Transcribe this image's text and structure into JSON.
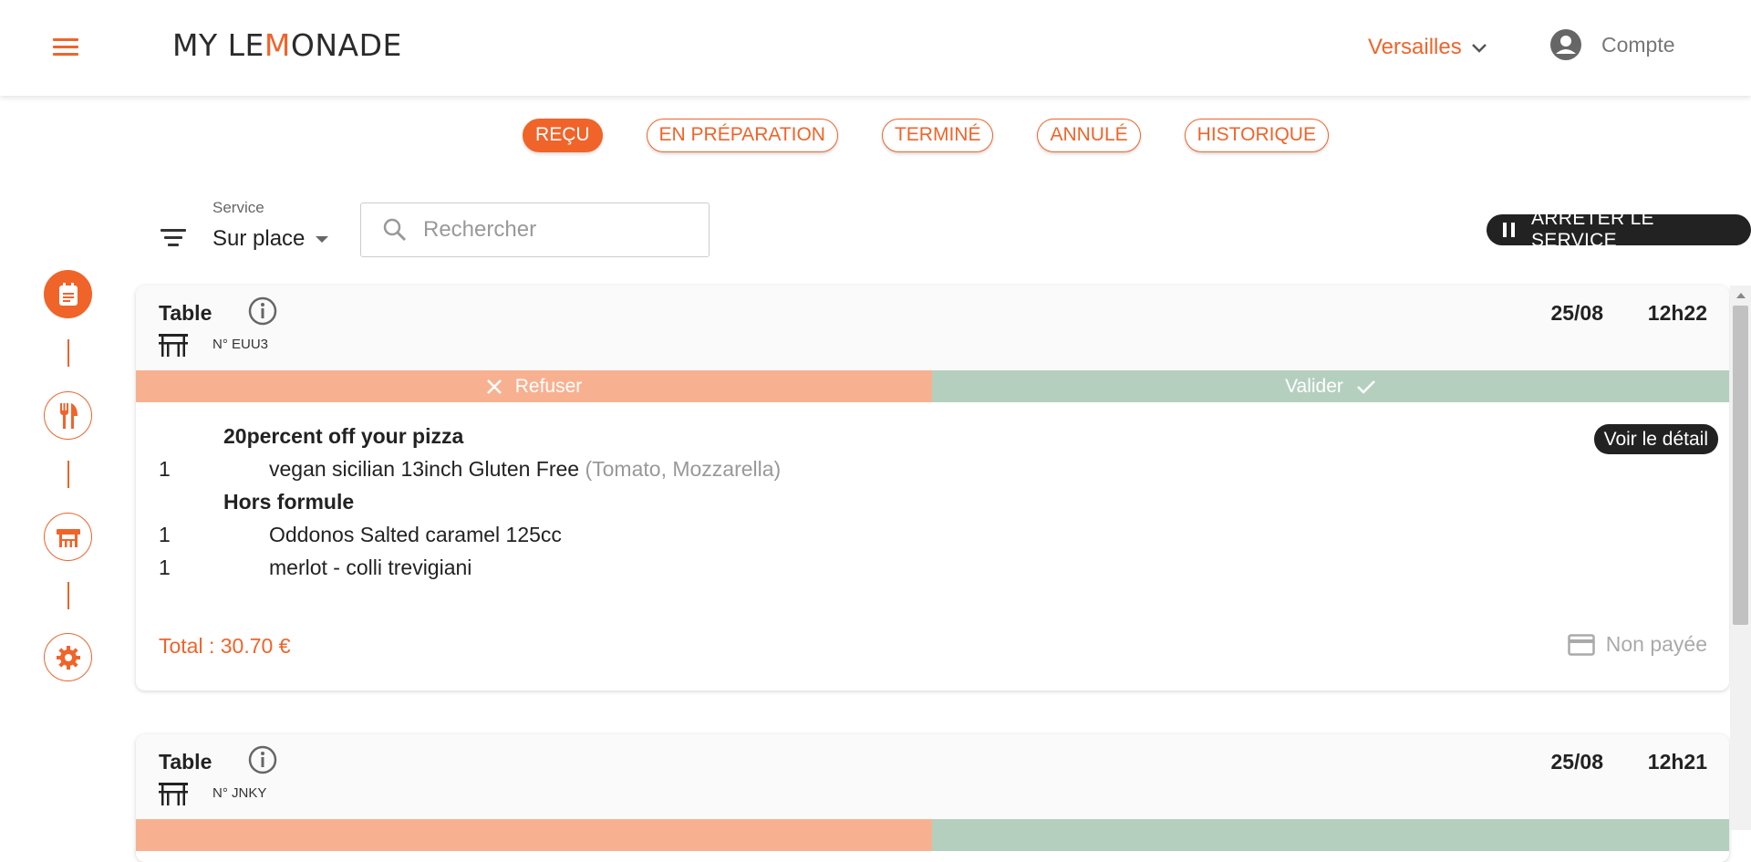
{
  "header": {
    "logo_text_a": "MY LE",
    "logo_text_m": "M",
    "logo_text_b": "ONADE",
    "city": "Versailles",
    "account_label": "Compte"
  },
  "tabs": [
    {
      "label": "REÇU",
      "active": true
    },
    {
      "label": "EN PRÉPARATION",
      "active": false
    },
    {
      "label": "TERMINÉ",
      "active": false
    },
    {
      "label": "ANNULÉ",
      "active": false
    },
    {
      "label": "HISTORIQUE",
      "active": false
    }
  ],
  "filters": {
    "service_label": "Service",
    "service_value": "Sur place",
    "search_placeholder": "Rechercher",
    "stop_service_label": "ARRÊTER LE SERVICE"
  },
  "rail": [
    "orders-icon",
    "cutlery-icon",
    "table-icon",
    "gear-icon"
  ],
  "orders": [
    {
      "type": "Table",
      "table_number": "N° EUU3",
      "date": "25/08",
      "time": "12h22",
      "refuse_label": "Refuser",
      "validate_label": "Valider",
      "detail_label": "Voir le détail",
      "groups": [
        {
          "title": "20percent off your pizza",
          "items": [
            {
              "qty": "1",
              "name": "vegan sicilian 13inch Gluten Free",
              "options": "(Tomato, Mozzarella)"
            }
          ]
        },
        {
          "title": "Hors formule",
          "items": [
            {
              "qty": "1",
              "name": "Oddonos Salted caramel 125cc",
              "options": ""
            },
            {
              "qty": "1",
              "name": "merlot - colli trevigiani",
              "options": ""
            }
          ]
        }
      ],
      "total": "Total : 30.70 €",
      "payment_status": "Non payée"
    },
    {
      "type": "Table",
      "table_number": "N° JNKY",
      "date": "25/08",
      "time": "12h21"
    }
  ],
  "colors": {
    "accent": "#f0642a",
    "refuse": "#f8b190",
    "validate": "#b5cfbf",
    "dark": "#222222"
  }
}
